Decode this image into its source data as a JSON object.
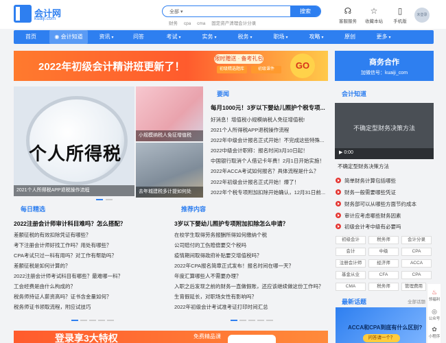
{
  "logo": {
    "name": "会计网",
    "domain": "kuaiji.com"
  },
  "search": {
    "category": "全部",
    "placeholder": "",
    "button": "搜索",
    "hot": [
      "财务",
      "cpa",
      "cma",
      "固定资产清理会计分录"
    ]
  },
  "tools": [
    {
      "label": "客服服务",
      "icon": "headset-icon",
      "glyph": "☊"
    },
    {
      "label": "收藏本站",
      "icon": "star-icon",
      "glyph": "☆"
    },
    {
      "label": "手机版",
      "icon": "mobile-icon",
      "glyph": "▯"
    }
  ],
  "user": {
    "avatar_text": "未登录"
  },
  "nav": [
    {
      "label": "首页",
      "dropdown": false
    },
    {
      "label": "会计知道",
      "dropdown": false,
      "active": true
    },
    {
      "label": "资讯",
      "dropdown": true
    },
    {
      "label": "问答",
      "dropdown": false
    },
    {
      "label": "考试",
      "dropdown": true
    },
    {
      "label": "实务",
      "dropdown": true
    },
    {
      "label": "税务",
      "dropdown": true
    },
    {
      "label": "职场",
      "dropdown": true
    },
    {
      "label": "攻略",
      "dropdown": true
    },
    {
      "label": "原创",
      "dropdown": false
    },
    {
      "label": "更多",
      "dropdown": true
    }
  ],
  "banner": {
    "title": "2022年初级会计精讲班更新了！",
    "tag": "限时赠送 · 备考礼包",
    "btn1": "初级精选题库",
    "btn2": "初级课件",
    "go": "GO"
  },
  "biz": {
    "title": "商务合作",
    "wechat": "加微信号：kuaiji_com"
  },
  "slides": {
    "main_word": "个人所得税",
    "main_caption": "2021个人所得税APP退税操作流程",
    "thumb1": "小规模纳税人免征增值税",
    "thumb2": "去年城建税多计提如何处"
  },
  "news": {
    "title": "要闻",
    "headline": "每月1000元！3岁以下婴幼儿照护个税专项...",
    "items": [
      "好消息！增值税小规模纳税人免征增值税!",
      "2021个人所得税APP退税操作流程",
      "2022年中级会计报名正式开始！不完成这些特殊...",
      "2022中级会计职称：报名时间3月10日起！",
      "中国银行取消个人借记卡年费！2月1日开始实施！",
      "2022年ACCA考试如何报名？具体流程是什么？",
      "2022年初级会计报名正式开始！爆了！",
      "2022年个税专项附加扣除开始确认，12月31日前..."
    ]
  },
  "daily": {
    "title": "每日精选",
    "headline": "2022注册会计师审计科目难吗？怎么搭配？",
    "items": [
      "差额征税的有效扣除凭证有哪些？",
      "考下注册会计师好找工作吗？用处有哪些？",
      "CPA考试只过一科有用吗？对工作有帮助吗？",
      "差额征税是如何计算的？",
      "2022注册会计师考试科目有哪些？最难哪一科？",
      "工会经费是由什么构成的？",
      "税务师持证人薪资高吗？证书含金量如何？",
      "税务师证书领取流程，附应试技巧"
    ]
  },
  "recommend": {
    "title": "推荐内容",
    "headline": "3岁以下婴幼儿照护专项附加扣除怎么申请？",
    "items": [
      "在校学生取得劳务报酬所得如何缴纳个税",
      "公司赔付的工伤赔偿要交个税吗",
      "疫情期间取得政府补贴要交增值税吗？",
      "2022年CPA报名简章正式发布！报名时间在哪一天？",
      "年度汇算哪些人不需要办理？",
      "入职之后发现之前的财务一直做假账，还应该继续做这份工作吗？",
      "生育假延长，对职场女性有影响吗？",
      "2022年初级会计考试准考证打印时间汇总"
    ]
  },
  "zhidao": {
    "title": "会计知道",
    "video_title": "不确定型财务决策方法",
    "video_time": "0:00",
    "caption": "不确定型财务决策方法",
    "items": [
      "简单财务计算包括哪些",
      "财务一般需要哪些凭证",
      "财务部可以从哪些方面节约成本",
      "审计应考虑哪些财务因素",
      "初级会计考中级有必要吗"
    ]
  },
  "tags": [
    "初级会计",
    "税务师",
    "会计分录",
    "会计",
    "中级",
    "CPA",
    "注册会计师",
    "经济师",
    "ACCA",
    "基金从业",
    "CFA",
    "CPA",
    "CMA",
    "税务师",
    "管理费用"
  ],
  "latest": {
    "title": "最新话题",
    "more": "全部话题",
    "card": "ACCA和CPA到底有什么区别?",
    "card_btn": "问答请一个？"
  },
  "floats": [
    {
      "label": "领福利",
      "icon": "gift-icon",
      "glyph": "♨"
    },
    {
      "label": "公众号",
      "icon": "wechat-icon",
      "glyph": "◎"
    },
    {
      "label": "小程序",
      "icon": "miniapp-icon",
      "glyph": "✿"
    }
  ],
  "bottom_banner": {
    "title": "登录享3大特权",
    "sub": "免费精品课"
  }
}
